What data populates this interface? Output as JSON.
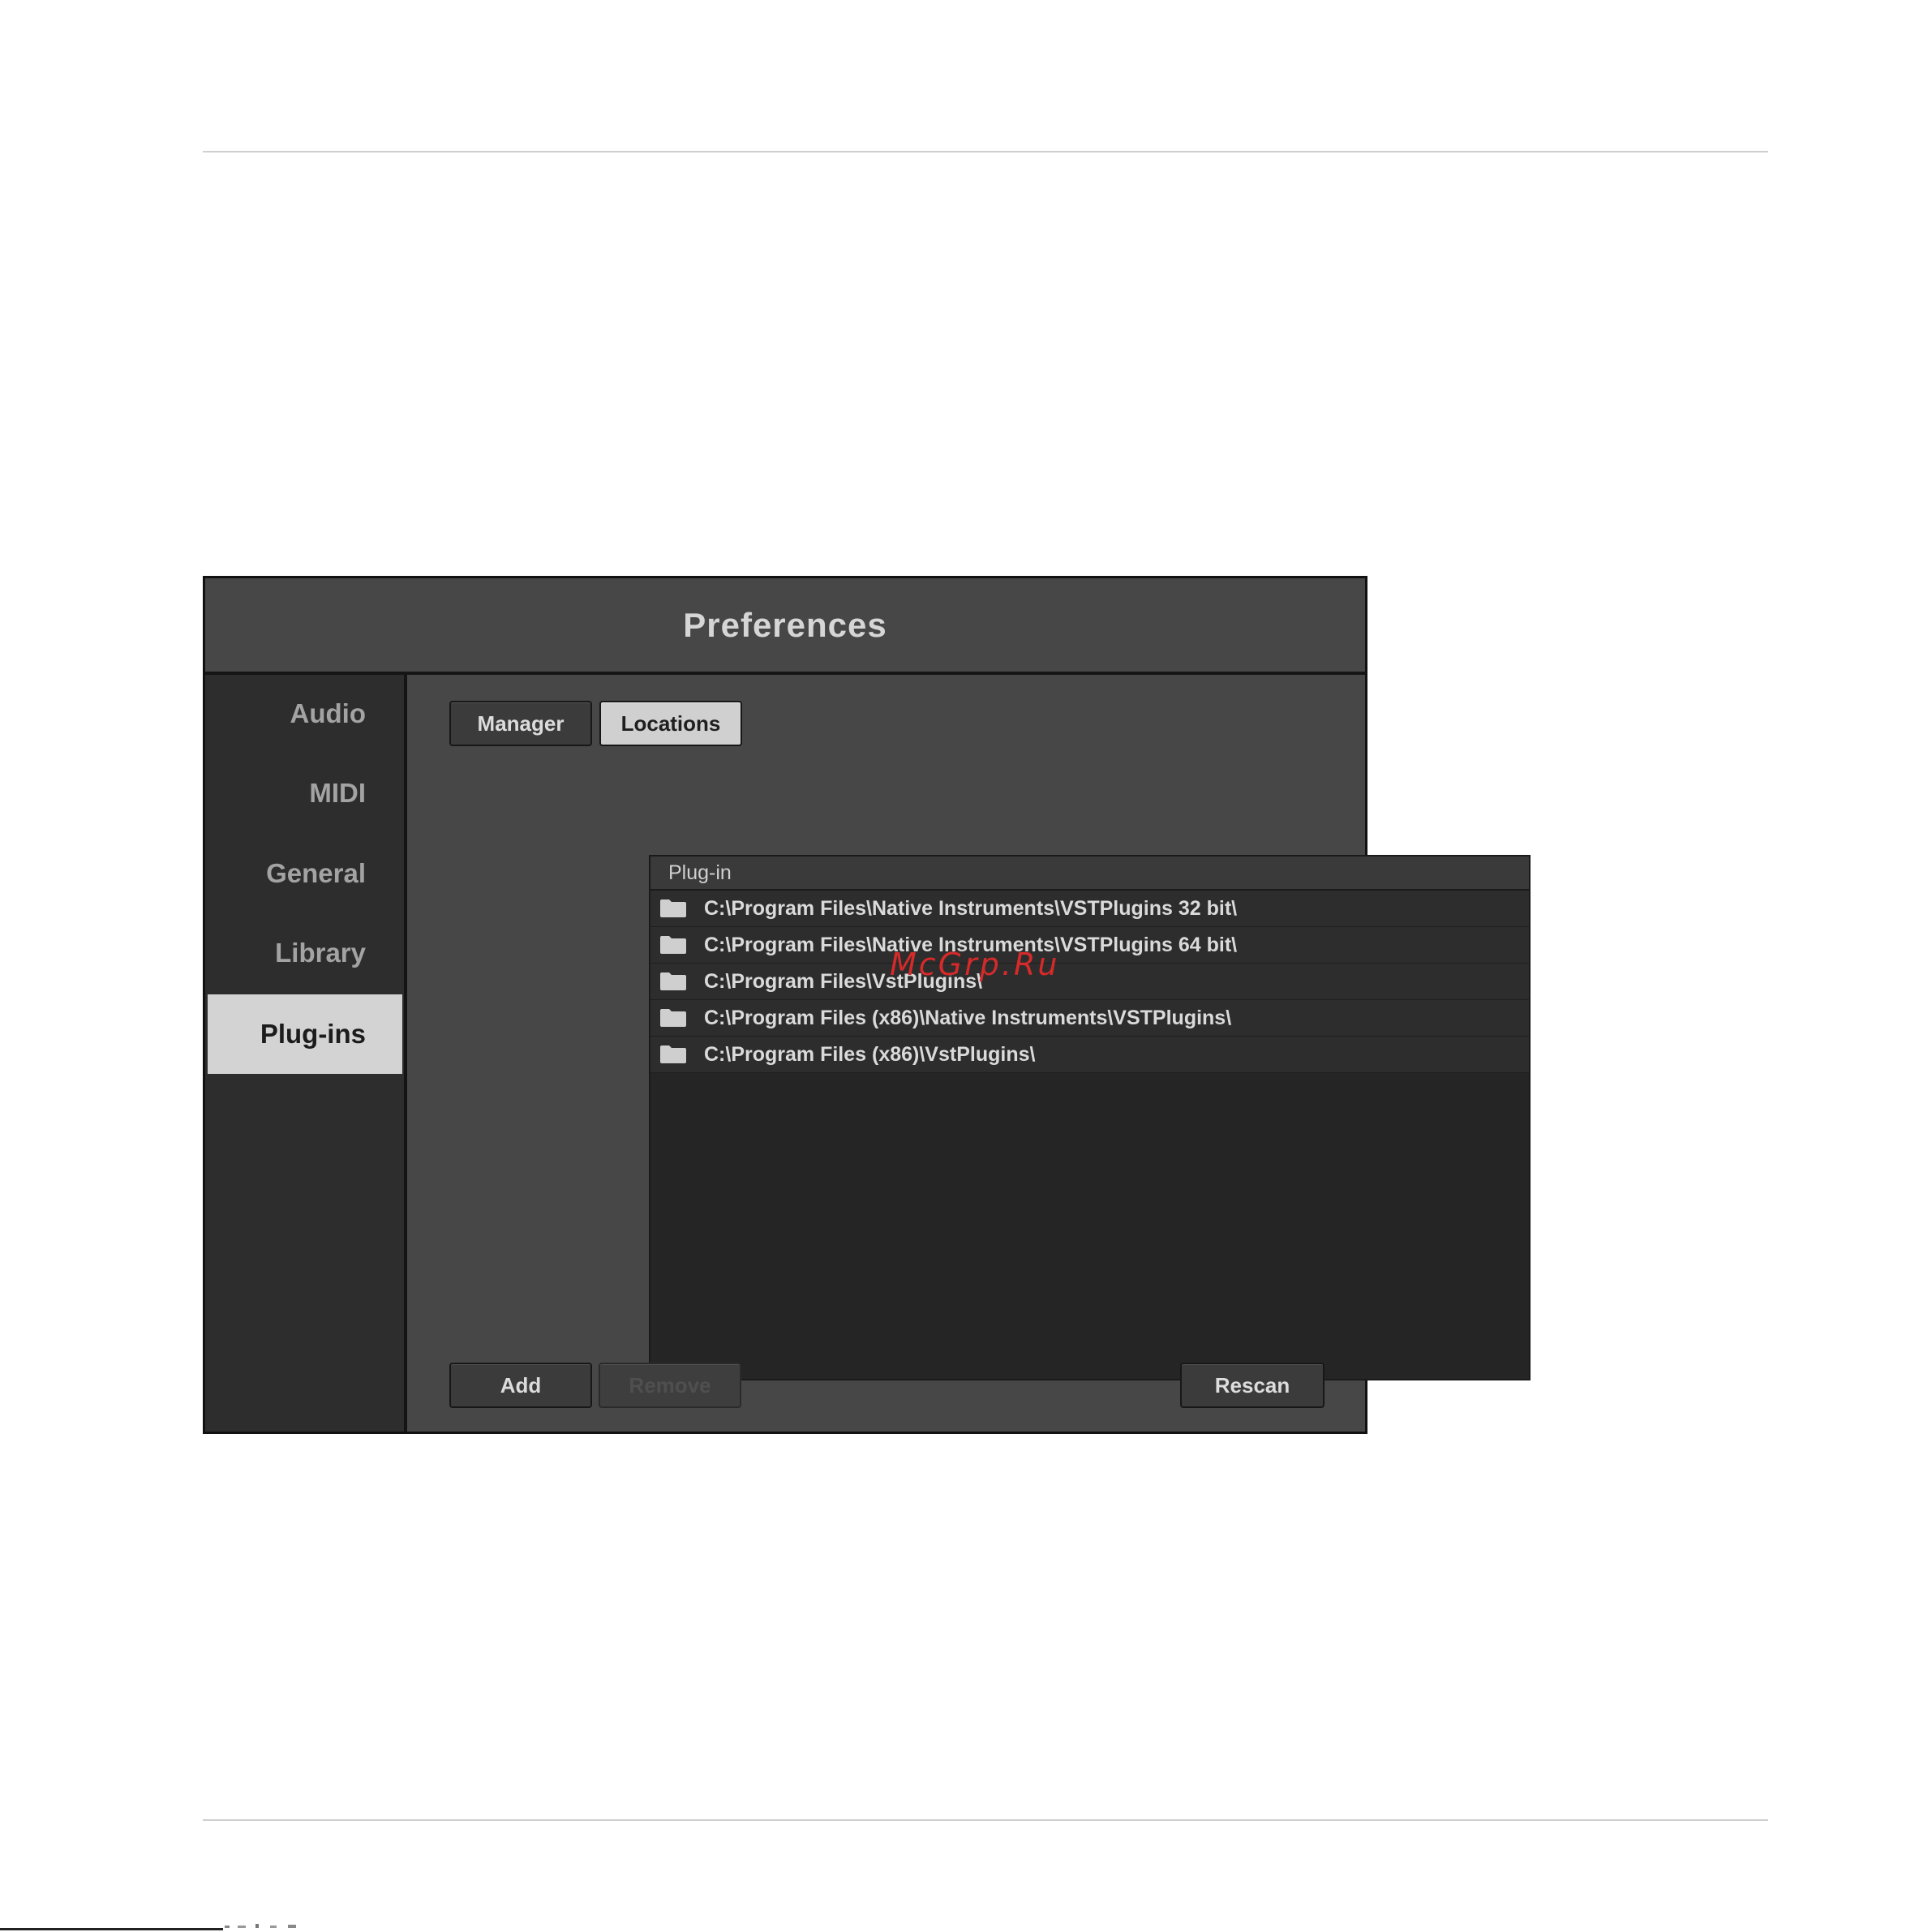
{
  "window": {
    "title": "Preferences"
  },
  "sidebar": {
    "items": [
      {
        "label": "Audio",
        "active": false
      },
      {
        "label": "MIDI",
        "active": false
      },
      {
        "label": "General",
        "active": false
      },
      {
        "label": "Library",
        "active": false
      },
      {
        "label": "Plug-ins",
        "active": true
      }
    ]
  },
  "tabs": [
    {
      "label": "Manager",
      "active": false
    },
    {
      "label": "Locations",
      "active": true
    }
  ],
  "list": {
    "header": "Plug-in",
    "rows": [
      {
        "icon": "folder-icon",
        "path": "C:\\Program Files\\Native Instruments\\VSTPlugins 32 bit\\"
      },
      {
        "icon": "folder-icon",
        "path": "C:\\Program Files\\Native Instruments\\VSTPlugins 64 bit\\"
      },
      {
        "icon": "folder-icon",
        "path": "C:\\Program Files\\VstPlugins\\"
      },
      {
        "icon": "folder-icon",
        "path": "C:\\Program Files (x86)\\Native Instruments\\VSTPlugins\\"
      },
      {
        "icon": "folder-icon",
        "path": "C:\\Program Files (x86)\\VstPlugins\\"
      }
    ]
  },
  "buttons": {
    "add": "Add",
    "remove": "Remove",
    "rescan": "Rescan"
  },
  "watermark": "McGrp.Ru"
}
